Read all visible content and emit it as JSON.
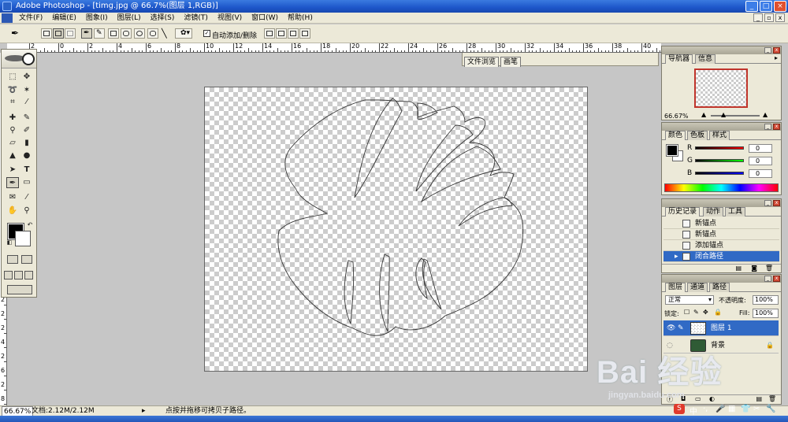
{
  "window": {
    "title": "Adobe Photoshop - [timg.jpg @ 66.7%(图层 1,RGB)]",
    "controls": [
      "_",
      "□",
      "×"
    ]
  },
  "menu": [
    "文件(F)",
    "编辑(E)",
    "图象(I)",
    "图层(L)",
    "选择(S)",
    "滤镜(T)",
    "视图(V)",
    "窗口(W)",
    "帮助(H)"
  ],
  "options": {
    "auto_add_delete_label": "自动添加/删除",
    "auto_add_delete_checked": true
  },
  "well_tabs": [
    "文件浏览",
    "画笔"
  ],
  "rulers": {
    "h_labels": [
      "2",
      "0",
      "2",
      "4",
      "6",
      "8",
      "10",
      "12",
      "14",
      "16",
      "18",
      "20",
      "22",
      "24",
      "26",
      "28",
      "30",
      "32",
      "34",
      "36",
      "38",
      "40",
      "42"
    ],
    "v_labels": [
      "0",
      "2",
      "4",
      "6",
      "8",
      "1",
      "0",
      "1",
      "2",
      "1",
      "4",
      "1",
      "6",
      "1",
      "8",
      "2",
      "0",
      "2",
      "2",
      "2",
      "4",
      "2",
      "6",
      "2",
      "8"
    ]
  },
  "navigator": {
    "tabs": [
      "导航器",
      "信息"
    ],
    "zoom": "66.67%"
  },
  "color": {
    "tabs": [
      "颜色",
      "色板",
      "样式"
    ],
    "channels": [
      {
        "label": "R",
        "value": "0"
      },
      {
        "label": "G",
        "value": "0"
      },
      {
        "label": "B",
        "value": "0"
      }
    ]
  },
  "history": {
    "tabs": [
      "历史记录",
      "动作",
      "工具"
    ],
    "items": [
      "新锚点",
      "新锚点",
      "添加锚点",
      "闭合路径"
    ],
    "selected_index": 3
  },
  "layers": {
    "tabs": [
      "图层",
      "通道",
      "路径"
    ],
    "blend_mode": "正常",
    "opacity_label": "不透明度:",
    "opacity_value": "100%",
    "lock_label": "锁定:",
    "fill_label": "Fill:",
    "fill_value": "100%",
    "items": [
      {
        "name": "图层 1",
        "selected": true
      },
      {
        "name": "背景",
        "selected": false
      }
    ]
  },
  "status": {
    "zoom": "66.67%",
    "doc_size": "文档:2.12M/2.12M",
    "hint": "点按并拖移可拷贝子路径。"
  },
  "watermark": {
    "brand": "Bai 经验",
    "url": "jingyan.baidu.com"
  },
  "tray": [
    "中",
    "·,",
    "♥",
    "▦",
    "👕",
    "✂"
  ],
  "colors": {
    "title_blue": "#1d56c9",
    "selection_blue": "#316ac5",
    "panel_bg": "#ece9d8",
    "nav_frame_red": "#c0342b"
  }
}
